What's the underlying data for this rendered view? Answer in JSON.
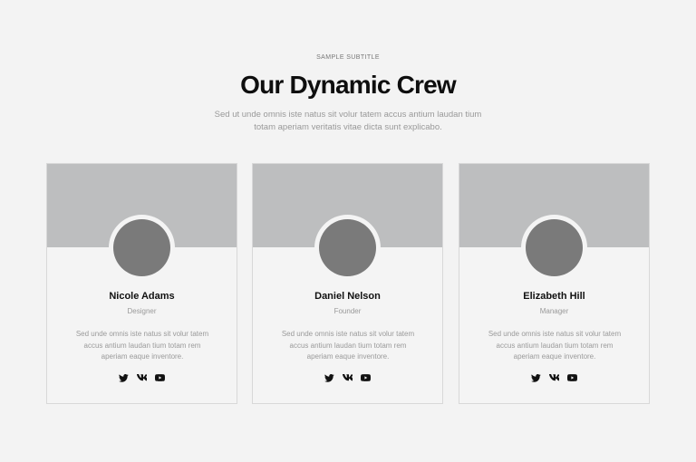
{
  "section": {
    "subtitle": "SAMPLE SUBTITLE",
    "title": "Our Dynamic Crew",
    "lead": "Sed ut unde omnis iste natus sit volur tatem accus antium laudan tium totam aperiam veritatis vitae dicta sunt explicabo."
  },
  "members": [
    {
      "name": "Nicole Adams",
      "role": "Designer",
      "bio": "Sed unde omnis iste natus sit volur tatem accus antium laudan tium totam rem aperiam eaque inventore.",
      "socials": [
        "twitter-icon",
        "vk-icon",
        "youtube-icon"
      ]
    },
    {
      "name": "Daniel Nelson",
      "role": "Founder",
      "bio": "Sed unde omnis iste natus sit volur tatem accus antium laudan tium totam rem aperiam eaque inventore.",
      "socials": [
        "twitter-icon",
        "vk-icon",
        "youtube-icon"
      ]
    },
    {
      "name": "Elizabeth Hill",
      "role": "Manager",
      "bio": "Sed unde omnis iste natus sit volur tatem accus antium laudan tium totam rem aperiam eaque inventore.",
      "socials": [
        "twitter-icon",
        "vk-icon",
        "youtube-icon"
      ]
    }
  ],
  "colors": {
    "background": "#f3f3f3",
    "banner": "#bdbebf",
    "avatar": "#7a7a7a",
    "text_dark": "#111111",
    "text_muted": "#999999"
  }
}
